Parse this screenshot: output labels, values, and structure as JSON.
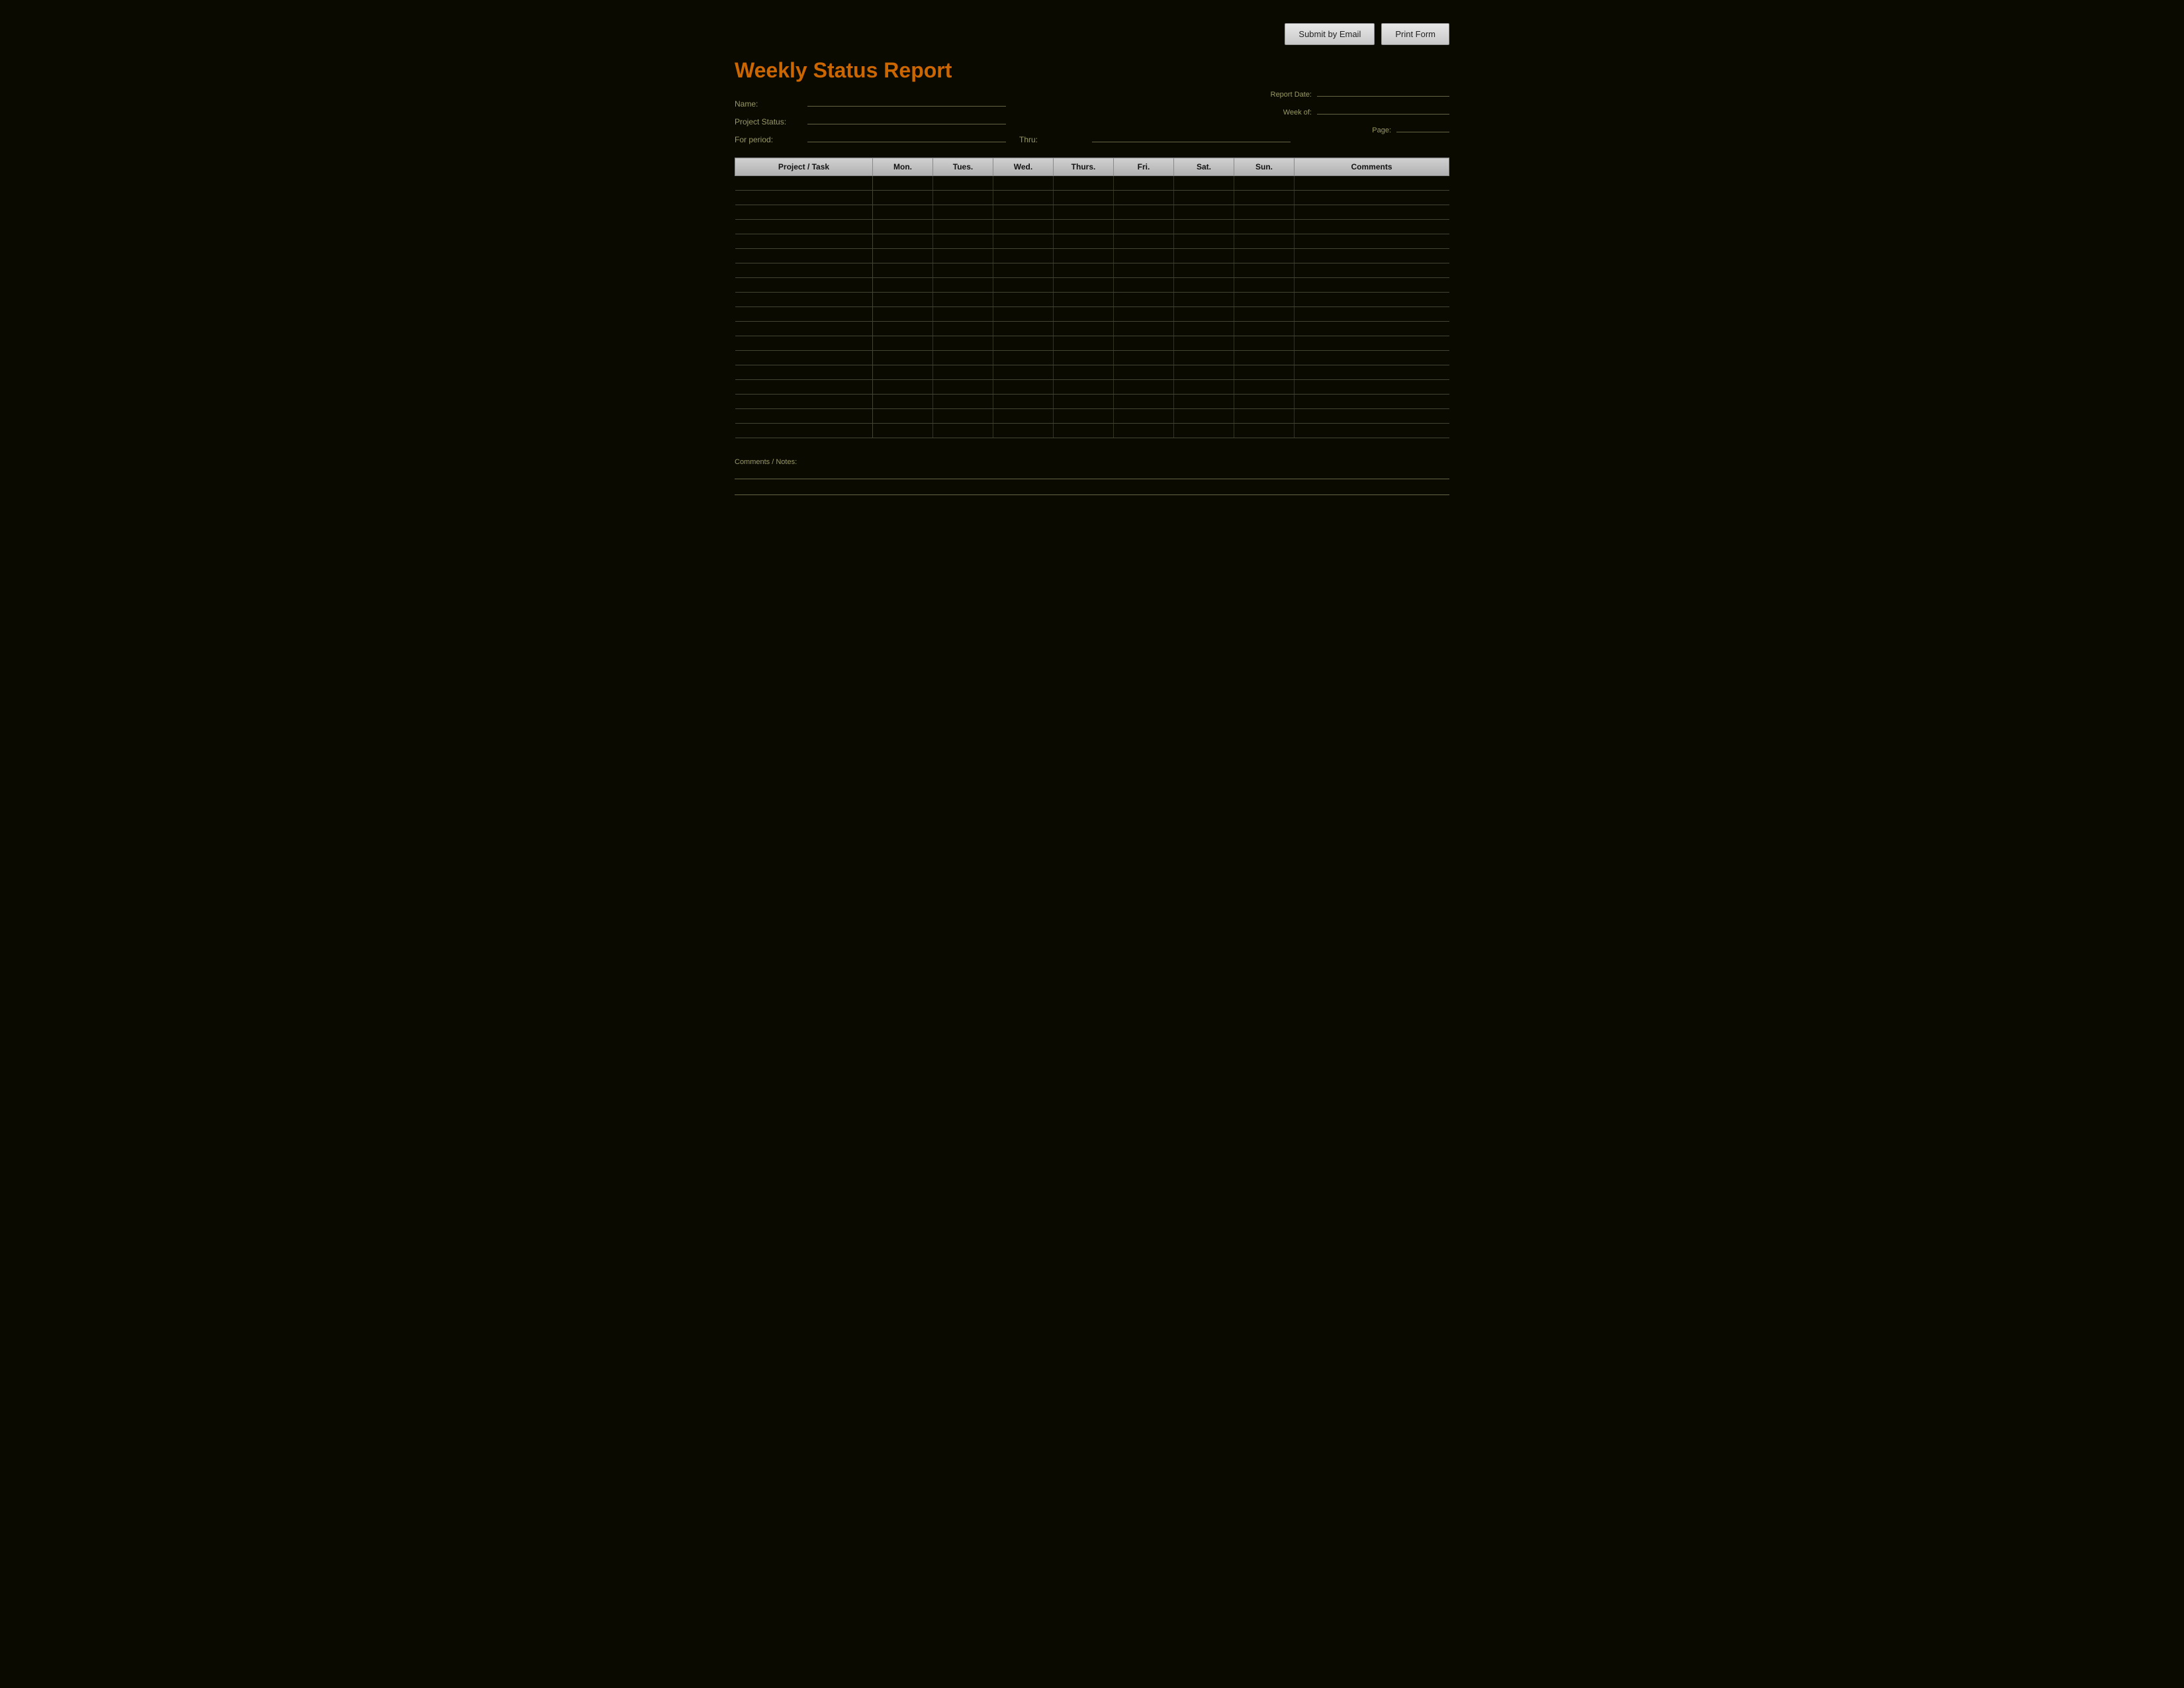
{
  "header": {
    "submit_email_label": "Submit by Email",
    "print_form_label": "Print Form"
  },
  "form": {
    "title": "Weekly Status Report",
    "labels": {
      "name": "Name:",
      "project_status": "Project Status:",
      "for_period": "For period:",
      "thru": "Thru:",
      "report_date": "Report Date:",
      "week_of": "Week of:",
      "page": "Page:"
    },
    "right_fields": {
      "label1": "Report Date:",
      "label2": "Week of:",
      "label3": "Page:"
    }
  },
  "table": {
    "columns": [
      "Project / Task",
      "Mon.",
      "Tues.",
      "Wed.",
      "Thurs.",
      "Fri.",
      "Sat.",
      "Sun.",
      "Comments"
    ],
    "num_rows": 18
  },
  "bottom": {
    "label": "Comments / Notes:"
  }
}
